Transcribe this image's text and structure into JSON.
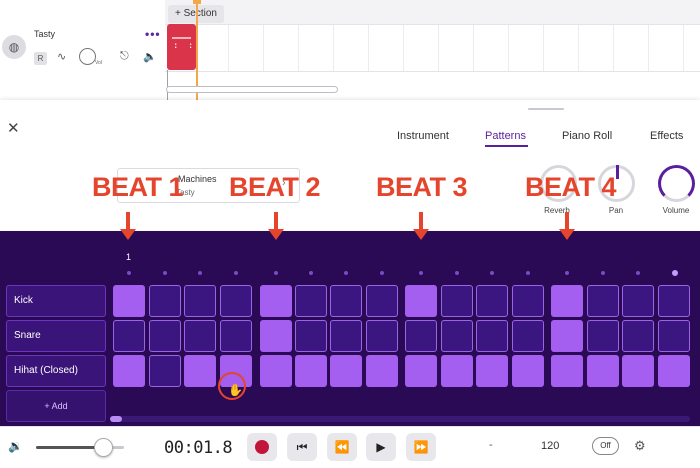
{
  "track": {
    "name": "Tasty",
    "record_label": "R",
    "volume_label": "Vol",
    "more_label": "•••",
    "section_label": "+ Section"
  },
  "tabs": [
    "Instrument",
    "Patterns",
    "Piano Roll",
    "Effects"
  ],
  "active_tab": "Patterns",
  "instrument": {
    "type": "Machines",
    "kit": "Tasty"
  },
  "knobs": {
    "reverb_label": "Reverb",
    "pan_label": "Pan",
    "volume_label": "Volume"
  },
  "annotations": [
    "BEAT 1",
    "BEAT 2",
    "BEAT 3",
    "BEAT 4"
  ],
  "sequencer": {
    "current_step_label": "1",
    "rows": [
      {
        "name": "Kick",
        "steps": [
          1,
          0,
          0,
          0,
          1,
          0,
          0,
          0,
          1,
          0,
          0,
          0,
          1,
          0,
          0,
          0
        ]
      },
      {
        "name": "Snare",
        "steps": [
          0,
          0,
          0,
          0,
          1,
          0,
          0,
          0,
          0,
          0,
          0,
          0,
          1,
          0,
          0,
          0
        ]
      },
      {
        "name": "Hihat (Closed)",
        "steps": [
          1,
          0,
          1,
          1,
          1,
          1,
          1,
          1,
          1,
          1,
          1,
          1,
          1,
          1,
          1,
          1
        ]
      }
    ],
    "add_label": "+  Add"
  },
  "transport": {
    "time": "00:01.8",
    "tempo_dash": "-",
    "tempo": "120",
    "metronome_label": "Off"
  },
  "colors": {
    "accent": "#5a1e9e",
    "pad_on": "#a45ef0",
    "sequencer_bg": "#2a0a55",
    "annotation": "#e4452c",
    "clip": "#d9344a",
    "record": "#c2153c"
  }
}
